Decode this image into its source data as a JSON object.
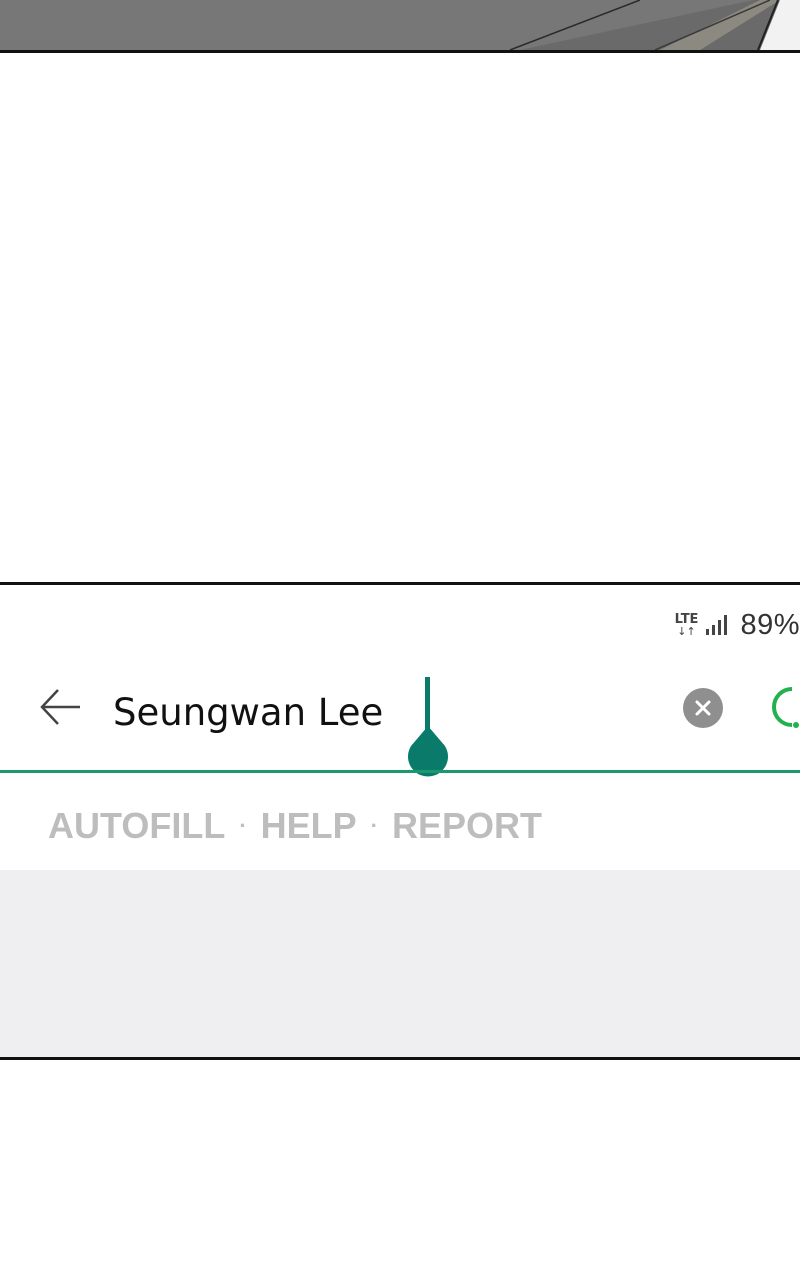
{
  "status_bar": {
    "network": "LTE",
    "network_arrows": "↓↑",
    "battery": "89%"
  },
  "search": {
    "value": "Seungwan Lee"
  },
  "links": [
    "AUTOFILL",
    "HELP",
    "REPORT"
  ],
  "link_separator": "·",
  "colors": {
    "accent": "#0a7b6b",
    "underline": "#1a9a6c",
    "spinner": "#22b14c",
    "link_gray": "#bdbdbd",
    "panel_gray": "#efeff1"
  },
  "icons": [
    "back-arrow-icon",
    "clear-icon",
    "loading-spinner-icon",
    "signal-icon"
  ]
}
